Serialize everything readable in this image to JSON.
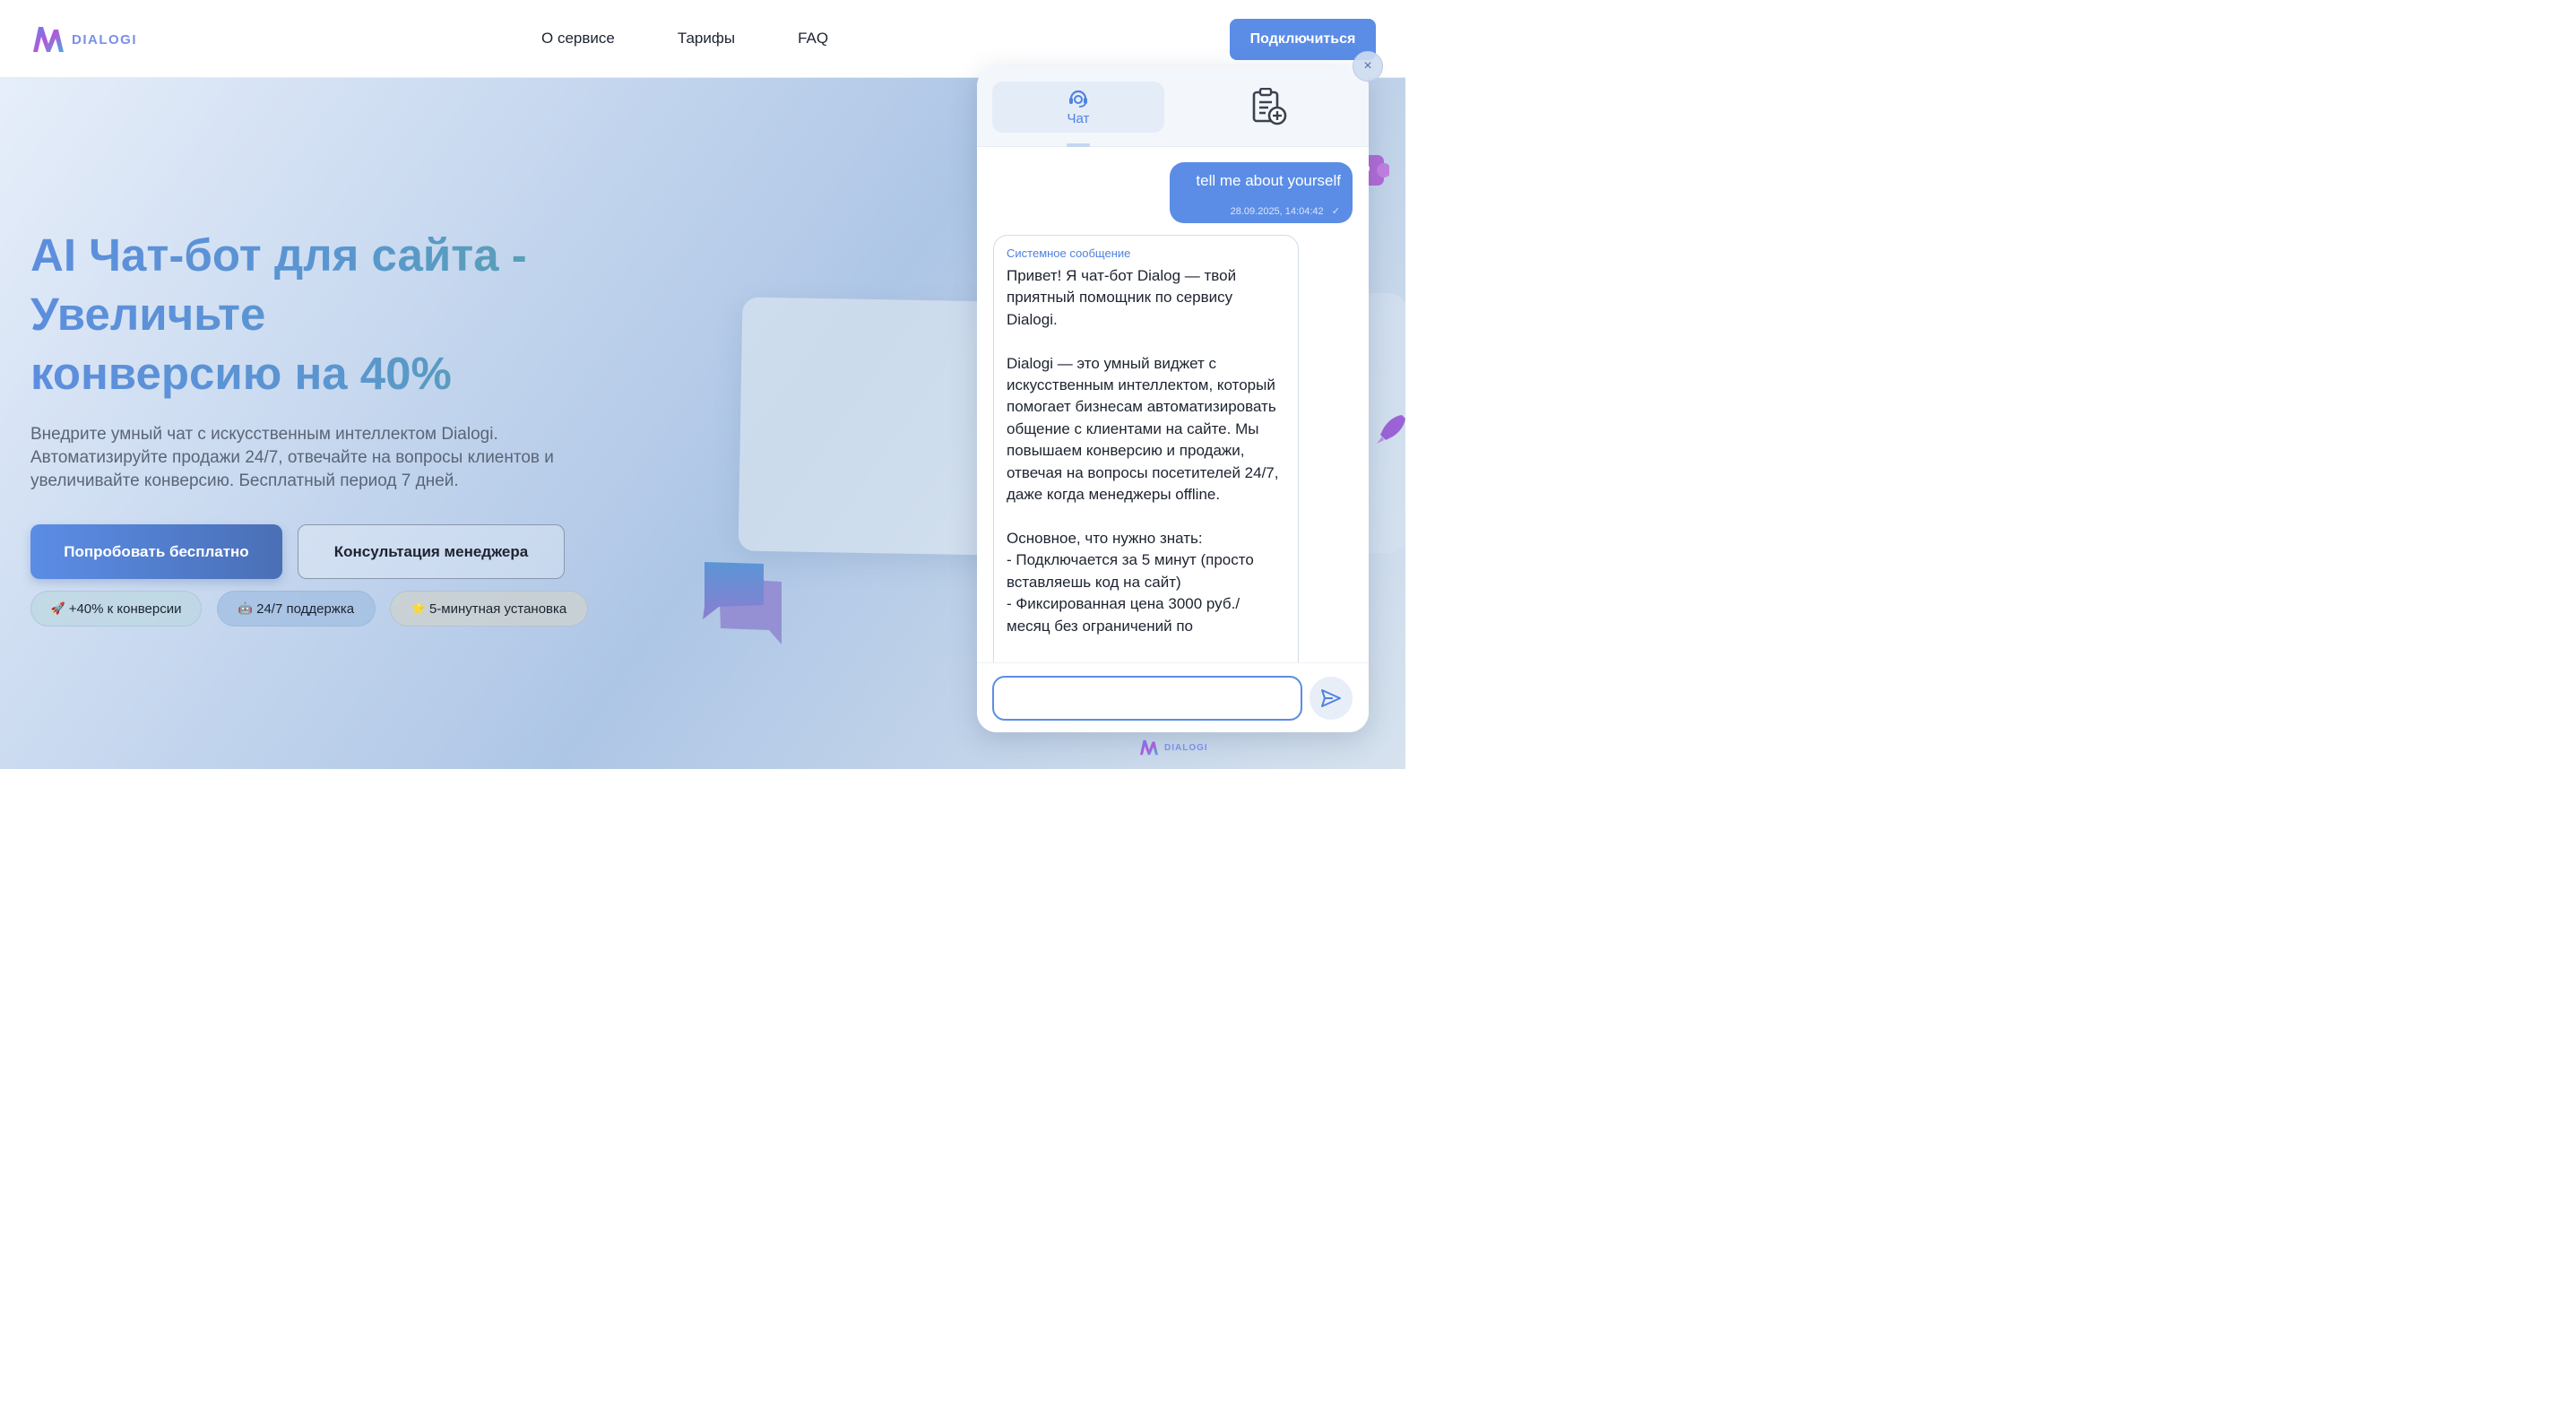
{
  "header": {
    "logo_text": "DIALOGI",
    "nav": [
      "О сервисе",
      "Тарифы",
      "FAQ"
    ],
    "connect_label": "Подключиться"
  },
  "hero": {
    "title_line1": "AI Чат-бот для сайта -",
    "title_line2": "Увеличьте",
    "title_line3": "конверсию на 40%",
    "subtitle": "Внедрите умный чат с искусственным интеллектом Dialogi. Автоматизируйте продажи 24/7, отвечайте на вопросы клиентов и увеличивайте конверсию. Бесплатный период 7 дней.",
    "primary_label": "Попробовать бесплатно",
    "secondary_label": "Консультация менеджера",
    "badges": [
      {
        "emoji": "🚀",
        "text": "+40% к конверсии"
      },
      {
        "emoji": "🤖",
        "text": "24/7 поддержка"
      },
      {
        "emoji": "⭐",
        "text": "5-минутная установка"
      }
    ]
  },
  "widget": {
    "tab_chat_label": "Чат",
    "close_symbol": "×",
    "user_message": {
      "text": "tell me about yourself",
      "time": "28.09.2025, 14:04:42",
      "status": "✓"
    },
    "bot_message": {
      "sender": "Системное сообщение",
      "text": "Привет! Я чат-бот Dialog — твой приятный помощник по сервису Dialogi.\n\nDialogi — это умный виджет с искусственным интеллектом, который помогает бизнесам автоматизировать общение с клиентами на сайте. Мы повышаем конверсию и продажи, отвечая на вопросы посетителей 24/7, даже когда менеджеры offline.\n\nОсновное, что нужно знать:\n- Подключается за 5 минут (просто вставляешь код на сайт)\n- Фиксированная цена 3000 руб./ месяц без ограничений по"
    },
    "input_value": "",
    "brand_text": "DIALOGI"
  },
  "colors": {
    "accent": "#5b8de6",
    "brand": "#7b8fe8",
    "text": "#1d2330"
  }
}
